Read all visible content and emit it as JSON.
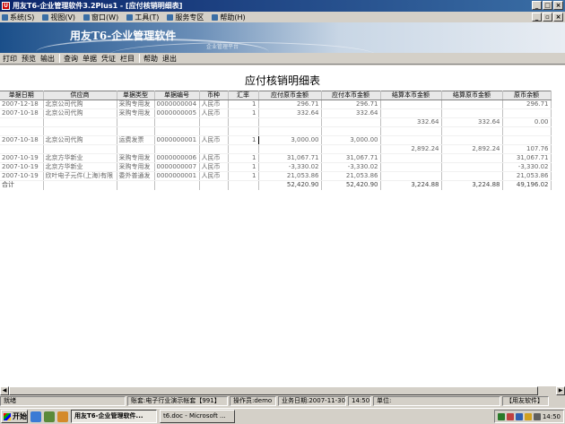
{
  "window": {
    "title": "用友T6-企业管理软件3.2Plus1  - [应付核销明细表]"
  },
  "menu": [
    "系统(S)",
    "视图(V)",
    "窗口(W)",
    "工具(T)",
    "服务专区",
    "帮助(H)"
  ],
  "banner": {
    "logo": "用友T6-企业管理软件",
    "subtitle": "企业管理平台"
  },
  "toolbar": [
    "打印",
    "预览",
    "输出",
    "查询",
    "单据",
    "凭证",
    "栏目",
    "帮助",
    "退出"
  ],
  "report": {
    "title": "应付核销明细表",
    "columns": [
      "单据日期",
      "供应商",
      "单据类型",
      "单据编号",
      "币种",
      "汇率",
      "应付原币金额",
      "应付本币金额",
      "结算本币金额",
      "结算原币金额",
      "原币余额"
    ],
    "rows": [
      [
        "2007-12-18",
        "北京公司代购",
        "采购专用发",
        "0000000004",
        "人民币",
        "1",
        "296.71",
        "296.71",
        "",
        "",
        "296.71"
      ],
      [
        "2007-10-18",
        "北京公司代购",
        "采购专用发",
        "0000000005",
        "人民币",
        "1",
        "332.64",
        "332.64",
        "",
        "",
        ""
      ],
      [
        "",
        "",
        "",
        "",
        "",
        "",
        "",
        "",
        "332.64",
        "332.64",
        "0.00"
      ],
      [
        "",
        "",
        "",
        "",
        "",
        "",
        "",
        "",
        "",
        "",
        ""
      ],
      [
        "2007-10-18",
        "北京公司代购",
        "运费发票",
        "0000000001",
        "人民币",
        "1",
        "3,000.00",
        "3,000.00",
        "",
        "",
        ""
      ],
      [
        "",
        "",
        "",
        "",
        "",
        "",
        "",
        "",
        "2,892.24",
        "2,892.24",
        "107.76"
      ],
      [
        "2007-10-19",
        "北京方华新业",
        "采购专用发",
        "0000000006",
        "人民币",
        "1",
        "31,067.71",
        "31,067.71",
        "",
        "",
        "31,067.71"
      ],
      [
        "2007-10-19",
        "北京方华新业",
        "采购专用发",
        "0000000007",
        "人民币",
        "1",
        "-3,330.02",
        "-3,330.02",
        "",
        "",
        "-3,330.02"
      ],
      [
        "2007-10-19",
        "欣叶电子元件(上海)有限",
        "委外普通发",
        "0000000001",
        "人民币",
        "1",
        "21,053.86",
        "21,053.86",
        "",
        "",
        "21,053.86"
      ],
      [
        "合计",
        "",
        "",
        "",
        "",
        "",
        "52,420.90",
        "52,420.90",
        "3,224.88",
        "3,224.88",
        "49,196.02"
      ]
    ]
  },
  "status": {
    "ready": "就绪",
    "account": "账套:电子行业演示帐套【991】",
    "operator": "操作员:demo",
    "biz_date": "业务日期:2007-11-30",
    "time": "14:50",
    "unit": "单位:",
    "brand": "【用友软件】"
  },
  "taskbar": {
    "start": "开始",
    "tasks": [
      "用友T6-企业管理软件...",
      "t6.doc - Microsoft ..."
    ],
    "clock": "14:50"
  },
  "colors": {
    "title_bar": "#0a246a",
    "banner": "#1b4f8a",
    "window_bg": "#d4d0c8"
  }
}
